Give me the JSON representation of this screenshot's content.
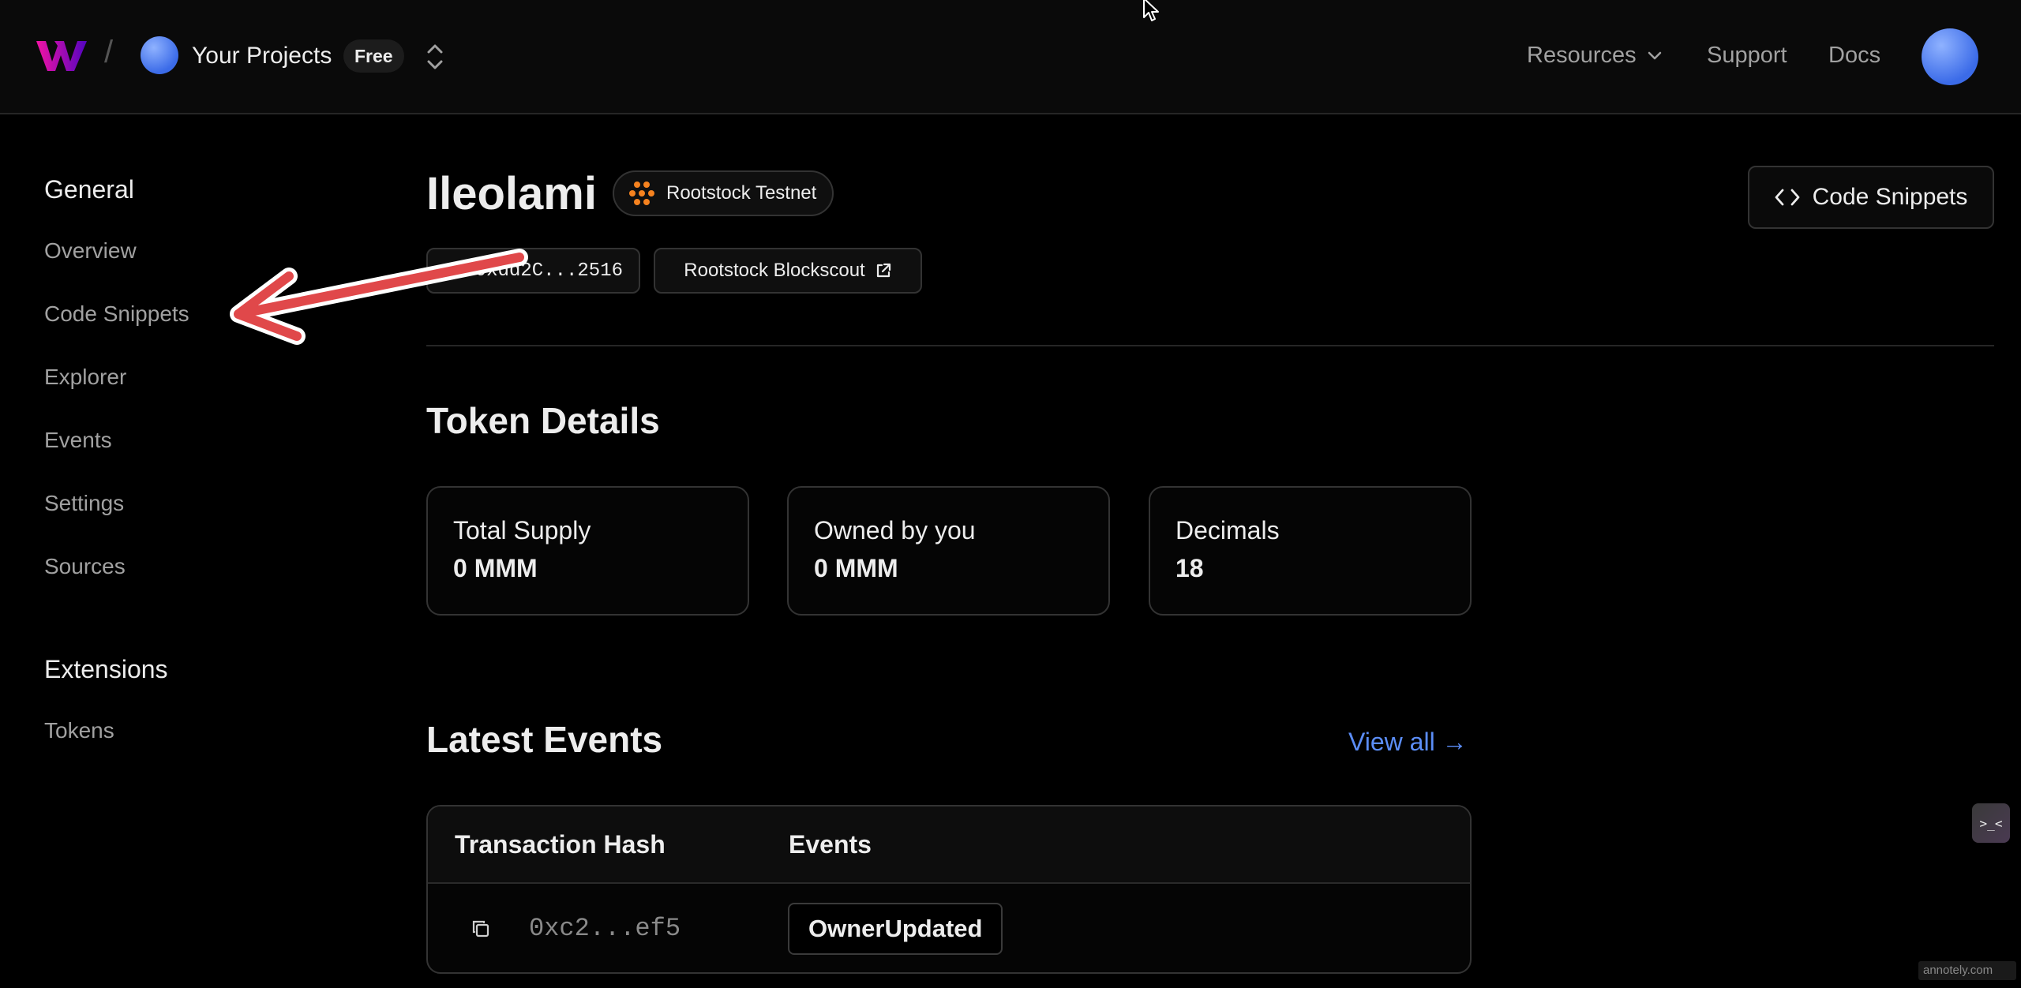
{
  "header": {
    "project_label": "Your Projects",
    "plan_badge": "Free",
    "nav": {
      "resources": "Resources",
      "support": "Support",
      "docs": "Docs"
    }
  },
  "sidebar": {
    "general_heading": "General",
    "items": [
      "Overview",
      "Code Snippets",
      "Explorer",
      "Events",
      "Settings",
      "Sources"
    ],
    "extensions_heading": "Extensions",
    "extension_items": [
      "Tokens"
    ]
  },
  "contract": {
    "name": "Ileolami",
    "network": "Rootstock Testnet",
    "address": "0xdd2C...2516",
    "explorer": "Rootstock Blockscout",
    "code_snippets_button": "Code Snippets"
  },
  "token_details": {
    "title": "Token Details",
    "cards": [
      {
        "label": "Total Supply",
        "value": "0 MMM"
      },
      {
        "label": "Owned by you",
        "value": "0 MMM"
      },
      {
        "label": "Decimals",
        "value": "18"
      }
    ]
  },
  "latest_events": {
    "title": "Latest Events",
    "view_all": "View all →",
    "columns": [
      "Transaction Hash",
      "Events"
    ],
    "rows": [
      {
        "hash": "0xc2...ef5",
        "event": "OwnerUpdated"
      }
    ]
  },
  "widgets": {
    "help_glyph": ">_<",
    "watermark": "annotely.com"
  },
  "colors": {
    "background": "#000000",
    "topbar": "#0a0a0a",
    "accent_link": "#5b8df7",
    "network_icon": "#f5821f",
    "annotation_arrow": "#e0484a"
  }
}
